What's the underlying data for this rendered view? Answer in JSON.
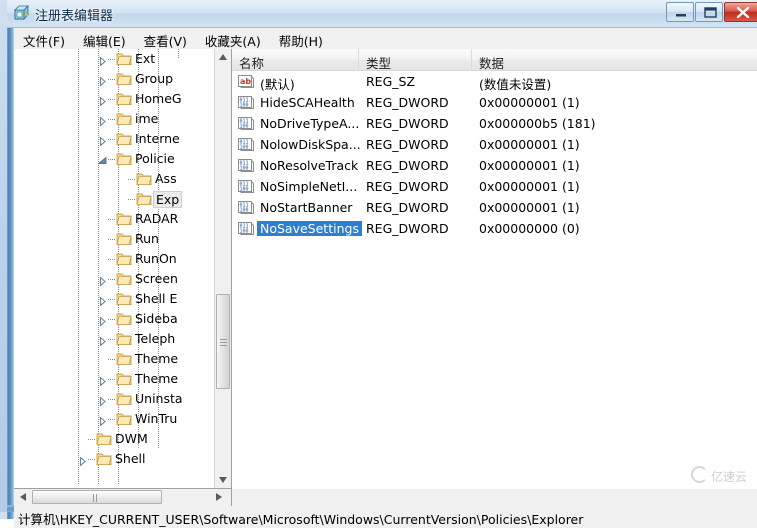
{
  "window": {
    "title": "注册表编辑器",
    "icon": "registry-editor-icon",
    "minimize_label": "",
    "maximize_label": "",
    "close_label": ""
  },
  "menubar": {
    "items": [
      {
        "label": "文件(F)",
        "name": "menu-file"
      },
      {
        "label": "编辑(E)",
        "name": "menu-edit"
      },
      {
        "label": "查看(V)",
        "name": "menu-view"
      },
      {
        "label": "收藏夹(A)",
        "name": "menu-favorites"
      },
      {
        "label": "帮助(H)",
        "name": "menu-help"
      }
    ]
  },
  "tree": {
    "items": [
      {
        "label": "Ext",
        "indent": 1,
        "expandable": true,
        "expanded": false,
        "selected": false
      },
      {
        "label": "Group",
        "indent": 1,
        "expandable": true,
        "expanded": false,
        "selected": false
      },
      {
        "label": "HomeG",
        "indent": 1,
        "expandable": true,
        "expanded": false,
        "selected": false
      },
      {
        "label": "ime",
        "indent": 1,
        "expandable": true,
        "expanded": false,
        "selected": false
      },
      {
        "label": "Interne",
        "indent": 1,
        "expandable": true,
        "expanded": false,
        "selected": false
      },
      {
        "label": "Policie",
        "indent": 1,
        "expandable": true,
        "expanded": true,
        "selected": false
      },
      {
        "label": "Ass",
        "indent": 2,
        "expandable": false,
        "expanded": false,
        "selected": false
      },
      {
        "label": "Exp",
        "indent": 2,
        "expandable": false,
        "expanded": false,
        "selected": true
      },
      {
        "label": "RADAR",
        "indent": 1,
        "expandable": false,
        "expanded": false,
        "selected": false
      },
      {
        "label": "Run",
        "indent": 1,
        "expandable": false,
        "expanded": false,
        "selected": false
      },
      {
        "label": "RunOn",
        "indent": 1,
        "expandable": false,
        "expanded": false,
        "selected": false
      },
      {
        "label": "Screen",
        "indent": 1,
        "expandable": true,
        "expanded": false,
        "selected": false
      },
      {
        "label": "Shell E",
        "indent": 1,
        "expandable": true,
        "expanded": false,
        "selected": false
      },
      {
        "label": "Sideba",
        "indent": 1,
        "expandable": true,
        "expanded": false,
        "selected": false
      },
      {
        "label": "Teleph",
        "indent": 1,
        "expandable": true,
        "expanded": false,
        "selected": false
      },
      {
        "label": "Theme",
        "indent": 1,
        "expandable": false,
        "expanded": false,
        "selected": false
      },
      {
        "label": "Theme",
        "indent": 1,
        "expandable": true,
        "expanded": false,
        "selected": false
      },
      {
        "label": "Uninsta",
        "indent": 1,
        "expandable": true,
        "expanded": false,
        "selected": false
      },
      {
        "label": "WinTru",
        "indent": 1,
        "expandable": true,
        "expanded": false,
        "selected": false
      },
      {
        "label": "DWM",
        "indent": 0,
        "expandable": false,
        "expanded": false,
        "selected": false
      },
      {
        "label": "Shell",
        "indent": 0,
        "expandable": true,
        "expanded": false,
        "selected": false
      }
    ]
  },
  "list": {
    "columns": [
      {
        "label": "名称",
        "name": "column-name"
      },
      {
        "label": "类型",
        "name": "column-type"
      },
      {
        "label": "数据",
        "name": "column-data"
      }
    ],
    "rows": [
      {
        "name": "(默认)",
        "type": "REG_SZ",
        "data": "(数值未设置)",
        "icon": "string-value-icon",
        "selected": false
      },
      {
        "name": "HideSCAHealth",
        "type": "REG_DWORD",
        "data": "0x00000001 (1)",
        "icon": "binary-value-icon",
        "selected": false
      },
      {
        "name": "NoDriveTypeA...",
        "type": "REG_DWORD",
        "data": "0x000000b5 (181)",
        "icon": "binary-value-icon",
        "selected": false
      },
      {
        "name": "NolowDiskSpa...",
        "type": "REG_DWORD",
        "data": "0x00000001 (1)",
        "icon": "binary-value-icon",
        "selected": false
      },
      {
        "name": "NoResolveTrack",
        "type": "REG_DWORD",
        "data": "0x00000001 (1)",
        "icon": "binary-value-icon",
        "selected": false
      },
      {
        "name": "NoSimpleNetI...",
        "type": "REG_DWORD",
        "data": "0x00000001 (1)",
        "icon": "binary-value-icon",
        "selected": false
      },
      {
        "name": "NoStartBanner",
        "type": "REG_DWORD",
        "data": "0x00000001 (1)",
        "icon": "binary-value-icon",
        "selected": false
      },
      {
        "name": "NoSaveSettings",
        "type": "REG_DWORD",
        "data": "0x00000000 (0)",
        "icon": "binary-value-icon",
        "selected": true
      }
    ]
  },
  "statusbar": {
    "path": "计算机\\HKEY_CURRENT_USER\\Software\\Microsoft\\Windows\\CurrentVersion\\Policies\\Explorer"
  },
  "watermark": {
    "text": "亿速云"
  },
  "colors": {
    "selection": "#2f7fd1",
    "title_bar": "#cfdff0",
    "window_frame": "#4a81b4",
    "close_button": "#bc2d1d",
    "pane_background": "#ffffff",
    "chrome_background": "#f0f0f0"
  }
}
